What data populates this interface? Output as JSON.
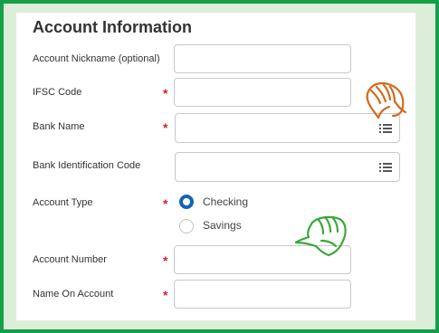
{
  "form": {
    "title": "Account Information",
    "fields": {
      "nickname": {
        "label": "Account Nickname (optional)",
        "value": ""
      },
      "ifsc": {
        "label": "IFSC Code",
        "required_mark": "*",
        "value": ""
      },
      "bank_name": {
        "label": "Bank Name",
        "required_mark": "*",
        "value": "",
        "icon": "list-icon"
      },
      "bank_id": {
        "label": "Bank Identification Code",
        "value": "",
        "icon": "list-icon"
      },
      "account_type": {
        "label": "Account Type",
        "required_mark": "*",
        "options": [
          "Checking",
          "Savings"
        ],
        "selected": "Checking"
      },
      "account_number": {
        "label": "Account Number",
        "required_mark": "*",
        "value": ""
      },
      "name_on_account": {
        "label": "Name On Account",
        "required_mark": "*",
        "value": ""
      }
    }
  },
  "colors": {
    "frame_border": "#13a049",
    "required": "#d6232a",
    "radio_selected": "#1464b8",
    "doodle_orange": "#d2691e",
    "doodle_green": "#3aa83a"
  },
  "annotations": [
    "pointing-hand-icon",
    "pointing-hand-icon"
  ]
}
